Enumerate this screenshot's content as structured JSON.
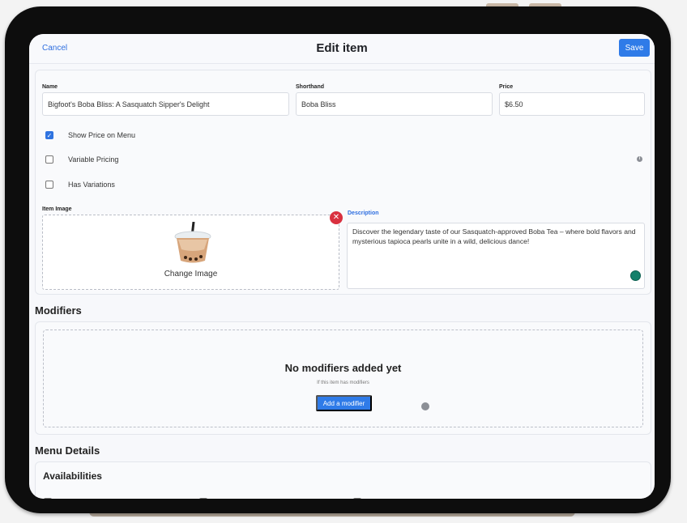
{
  "header": {
    "cancel_label": "Cancel",
    "title": "Edit item",
    "save_label": "Save"
  },
  "fields": {
    "name_label": "Name",
    "name_value": "Bigfoot's Boba Bliss: A Sasquatch Sipper's Delight",
    "shorthand_label": "Shorthand",
    "shorthand_value": "Boba Bliss",
    "price_label": "Price",
    "price_value": "$6.50"
  },
  "options": [
    {
      "label": "Show Price on Menu",
      "checked": true
    },
    {
      "label": "Variable Pricing",
      "checked": false
    },
    {
      "label": "Has Variations",
      "checked": false
    }
  ],
  "image": {
    "label": "Item Image",
    "change_label": "Change Image"
  },
  "description": {
    "label": "Description",
    "value": "Discover the legendary taste of our Sasquatch-approved Boba Tea – where bold flavors and mysterious tapioca pearls unite in a wild, delicious dance!"
  },
  "modifiers": {
    "title": "Modifiers",
    "empty_title": "No modifiers added yet",
    "empty_subtitle": "If this item has modifiers",
    "add_label": "Add a modifier"
  },
  "menu_details": {
    "title": "Menu Details",
    "availabilities_title": "Availabilities"
  },
  "colors": {
    "accent": "#2f7be8",
    "remove": "#d9303f",
    "grammar_badge": "#14806b"
  },
  "icons": {
    "remove": "close-icon",
    "info": "info-icon",
    "checkbox": "check-icon"
  }
}
